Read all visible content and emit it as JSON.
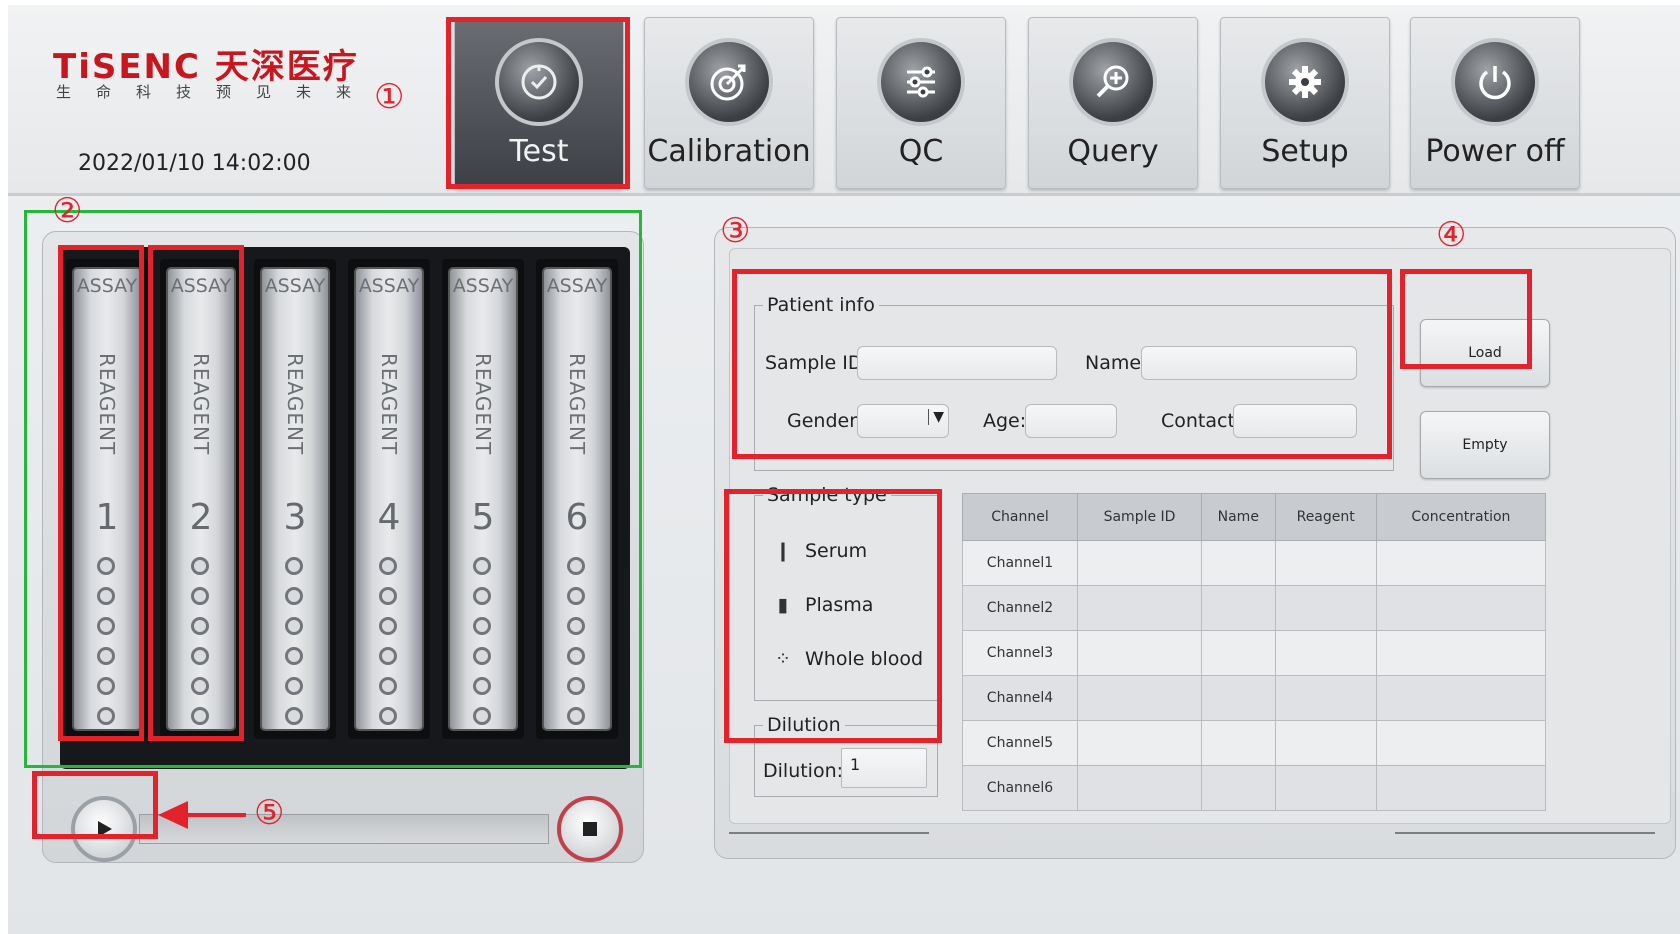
{
  "brand": {
    "name": "TiSENC 天深医疗",
    "tagline": "生命科技预见未来"
  },
  "datetime": "2022/01/10  14:02:00",
  "nav": {
    "items": [
      {
        "label": "Test",
        "icon": "gauge-check-icon",
        "active": true
      },
      {
        "label": "Calibration",
        "icon": "target-arrow-icon",
        "active": false
      },
      {
        "label": "QC",
        "icon": "sliders-icon",
        "active": false
      },
      {
        "label": "Query",
        "icon": "magnifier-plus-icon",
        "active": false
      },
      {
        "label": "Setup",
        "icon": "gear-icon",
        "active": false
      },
      {
        "label": "Power off",
        "icon": "power-icon",
        "active": false
      }
    ]
  },
  "annotations": {
    "c1": "①",
    "c2": "②",
    "c3": "③",
    "c4": "④",
    "c5": "⑤",
    "highlight_color": "#e3232b",
    "group_color": "#27b53a"
  },
  "reagent_slots": [
    {
      "assay": "ASSAY",
      "reagent": "REAGENT",
      "number": "1"
    },
    {
      "assay": "ASSAY",
      "reagent": "REAGENT",
      "number": "2"
    },
    {
      "assay": "ASSAY",
      "reagent": "REAGENT",
      "number": "3"
    },
    {
      "assay": "ASSAY",
      "reagent": "REAGENT",
      "number": "4"
    },
    {
      "assay": "ASSAY",
      "reagent": "REAGENT",
      "number": "5"
    },
    {
      "assay": "ASSAY",
      "reagent": "REAGENT",
      "number": "6"
    }
  ],
  "patient_info": {
    "legend": "Patient info",
    "sample_id_label": "Sample ID:",
    "sample_id_value": "",
    "name_label": "Name:",
    "name_value": "",
    "gender_label": "Gender:",
    "gender_value": "",
    "age_label": "Age:",
    "age_value": "",
    "contact_label": "Contact:",
    "contact_value": ""
  },
  "buttons": {
    "load": "Load",
    "empty": "Empty"
  },
  "sample_type": {
    "legend": "Sample type",
    "options": [
      {
        "label": "Serum",
        "icon": "tube-icon"
      },
      {
        "label": "Plasma",
        "icon": "tube-icon"
      },
      {
        "label": "Whole blood",
        "icon": "drops-icon"
      }
    ]
  },
  "dilution": {
    "legend": "Dilution",
    "label": "Dilution:",
    "value": "1"
  },
  "channels_table": {
    "headers": [
      "Channel",
      "Sample ID",
      "Name",
      "Reagent",
      "Concentration"
    ],
    "rows": [
      [
        "Channel1",
        "",
        "",
        "",
        ""
      ],
      [
        "Channel2",
        "",
        "",
        "",
        ""
      ],
      [
        "Channel3",
        "",
        "",
        "",
        ""
      ],
      [
        "Channel4",
        "",
        "",
        "",
        ""
      ],
      [
        "Channel5",
        "",
        "",
        "",
        ""
      ],
      [
        "Channel6",
        "",
        "",
        "",
        ""
      ]
    ]
  }
}
